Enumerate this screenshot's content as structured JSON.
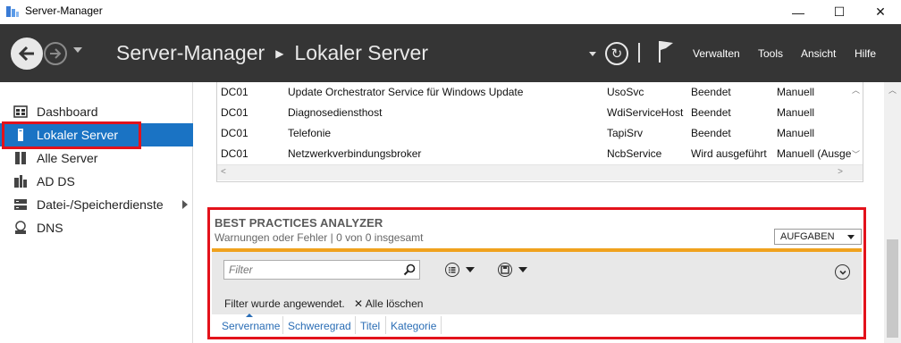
{
  "window": {
    "title": "Server-Manager",
    "controls": {
      "minimize": "—",
      "maximize": "☐",
      "close": "✕"
    }
  },
  "header": {
    "breadcrumb_root": "Server-Manager",
    "breadcrumb_separator": "▶",
    "breadcrumb_current": "Lokaler Server",
    "refresh_glyph": "↻",
    "menu": [
      "Verwalten",
      "Tools",
      "Ansicht",
      "Hilfe"
    ]
  },
  "sidebar": {
    "items": [
      {
        "label": "Dashboard",
        "icon": "dashboard-icon"
      },
      {
        "label": "Lokaler Server",
        "icon": "server-icon",
        "active": true
      },
      {
        "label": "Alle Server",
        "icon": "servers-icon"
      },
      {
        "label": "AD DS",
        "icon": "ad-ds-icon"
      },
      {
        "label": "Datei-/Speicherdienste",
        "icon": "storage-icon",
        "expandable": true
      },
      {
        "label": "DNS",
        "icon": "dns-icon"
      }
    ]
  },
  "services": {
    "rows": [
      [
        "DC01",
        "Update Orchestrator Service für Windows Update",
        "UsoSvc",
        "Beendet",
        "Manuell"
      ],
      [
        "DC01",
        "Diagnosediensthost",
        "WdiServiceHost",
        "Beendet",
        "Manuell"
      ],
      [
        "DC01",
        "Telefonie",
        "TapiSrv",
        "Beendet",
        "Manuell"
      ],
      [
        "DC01",
        "Netzwerkverbindungsbroker",
        "NcbService",
        "Wird ausgeführt",
        "Manuell (Ausge"
      ]
    ]
  },
  "bpa": {
    "title": "BEST PRACTICES ANALYZER",
    "subtitle": "Warnungen oder Fehler | 0 von 0 insgesamt",
    "tasks_label": "AUFGABEN",
    "filter_placeholder": "Filter",
    "filter_status": "Filter wurde angewendet.",
    "clear_all": "Alle löschen",
    "clear_glyph": "✕",
    "columns": [
      "Servername",
      "Schweregrad",
      "Titel",
      "Kategorie"
    ]
  },
  "colors": {
    "header_bg": "#353535",
    "active_item": "#1a73c4",
    "highlight_red": "#e3121b",
    "filter_accent": "#f0a21e",
    "link_blue": "#2a6db5"
  }
}
